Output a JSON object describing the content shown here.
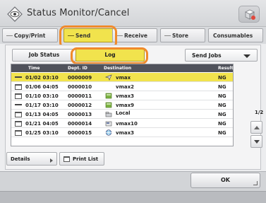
{
  "title": "Status Monitor/Cancel",
  "tabs": [
    {
      "label": "Copy/Print"
    },
    {
      "label": "Send"
    },
    {
      "label": "Receive"
    },
    {
      "label": "Store"
    },
    {
      "label": "Consumables"
    }
  ],
  "subtabs": {
    "job_status": "Job Status",
    "log": "Log"
  },
  "dropdown": {
    "selected": "Send Jobs"
  },
  "table": {
    "headers": {
      "time": "Time",
      "dept": "Dept. ID",
      "destination": "Destination",
      "result": "Result"
    },
    "rows": [
      {
        "time": "01/02 03:10",
        "dept": "0000009",
        "dest": "vmax",
        "result": "NG"
      },
      {
        "time": "01/06 04:05",
        "dept": "0000010",
        "dest": "vmax2",
        "result": "NG"
      },
      {
        "time": "01/10 03:10",
        "dept": "0000011",
        "dest": "vmax3",
        "result": "NG"
      },
      {
        "time": "01/17 03:10",
        "dept": "0000012",
        "dest": "vmax9",
        "result": "NG"
      },
      {
        "time": "01/13 04:05",
        "dept": "0000013",
        "dest": "Local",
        "result": "NG"
      },
      {
        "time": "01/21 04:05",
        "dept": "0000014",
        "dest": "vmax10",
        "result": "NG"
      },
      {
        "time": "01/25 03:10",
        "dept": "0000015",
        "dest": "vmax3",
        "result": "NG"
      }
    ]
  },
  "page_indicator": "1/2",
  "buttons": {
    "details": "Details",
    "print_list": "Print List",
    "ok": "OK"
  },
  "colors": {
    "highlight": "#f1e34d",
    "callout": "#f08a2b",
    "header": "#50525b"
  }
}
